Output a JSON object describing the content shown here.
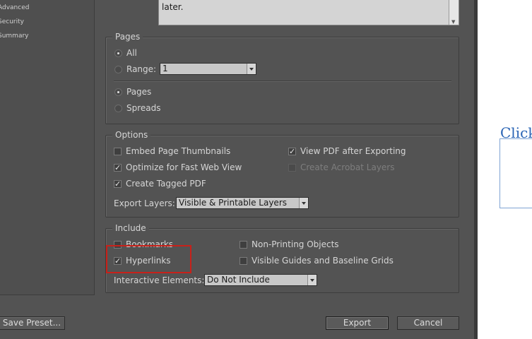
{
  "sidebar": {
    "items": [
      {
        "label": "Advanced"
      },
      {
        "label": "Security"
      },
      {
        "label": "Summary"
      }
    ]
  },
  "summary": {
    "text": "later."
  },
  "pages": {
    "title": "Pages",
    "all_label": "All",
    "range_label": "Range:",
    "range_value": "1",
    "pages_label": "Pages",
    "spreads_label": "Spreads",
    "selected_scope": "All",
    "selected_layout": "Pages"
  },
  "options": {
    "title": "Options",
    "embed_thumbnails": {
      "label": "Embed Page Thumbnails",
      "checked": false
    },
    "optimize_web": {
      "label": "Optimize for Fast Web View",
      "checked": true
    },
    "tagged_pdf": {
      "label": "Create Tagged PDF",
      "checked": true
    },
    "view_after": {
      "label": "View PDF after Exporting",
      "checked": true
    },
    "acrobat_layers": {
      "label": "Create Acrobat Layers",
      "checked": false,
      "disabled": true
    },
    "export_layers_label": "Export Layers:",
    "export_layers_value": "Visible & Printable Layers"
  },
  "include": {
    "title": "Include",
    "bookmarks": {
      "label": "Bookmarks",
      "checked": false
    },
    "hyperlinks": {
      "label": "Hyperlinks",
      "checked": true
    },
    "non_printing": {
      "label": "Non-Printing Objects",
      "checked": false
    },
    "guides": {
      "label": "Visible Guides and Baseline Grids",
      "checked": false
    },
    "interactive_label": "Interactive Elements:",
    "interactive_value": "Do Not Include"
  },
  "buttons": {
    "save_preset": "Save Preset...",
    "export": "Export",
    "cancel": "Cancel"
  },
  "document": {
    "text": "Click"
  },
  "colors": {
    "dialog_bg": "#535353",
    "highlight": "#c8211a",
    "doc_link": "#2a64b5"
  }
}
